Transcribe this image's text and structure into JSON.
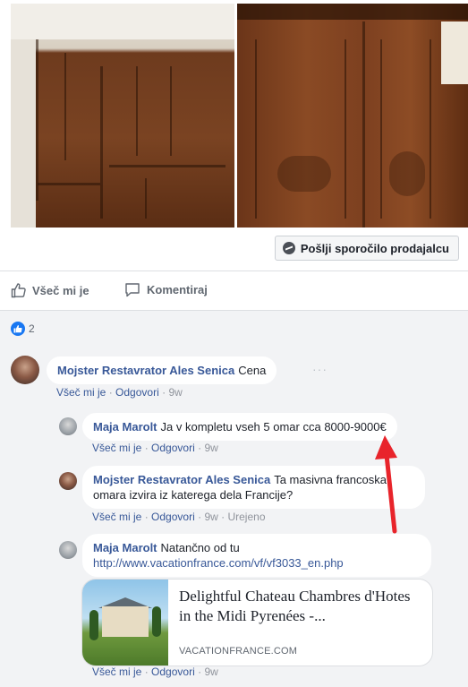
{
  "message_button": {
    "label": "Pošlji sporočilo prodajalcu",
    "icon": "messenger-icon"
  },
  "actions": {
    "like_label": "Všeč mi je",
    "comment_label": "Komentiraj"
  },
  "reactions": {
    "count": "2",
    "icon": "like-reaction-icon"
  },
  "comments": [
    {
      "author": "Mojster Restavrator Ales Senica",
      "text": "Cena",
      "like": "Všeč mi je",
      "reply": "Odgovori",
      "time": "9w",
      "more": "···"
    },
    {
      "author": "Maja Marolt",
      "text": "Ja v kompletu vseh 5 omar cca 8000-9000€",
      "like": "Všeč mi je",
      "reply": "Odgovori",
      "time": "9w"
    },
    {
      "author": "Mojster Restavrator Ales Senica",
      "text": "Ta masivna francoska omara izvira iz katerega dela Francije?",
      "like": "Všeč mi je",
      "reply": "Odgovori",
      "time": "9w",
      "edited": "Urejeno"
    },
    {
      "author": "Maja Marolt",
      "text": "Natančno od tu",
      "url": "http://www.vacationfrance.com/vf/vf3033_en.php",
      "like": "Všeč mi je",
      "reply": "Odgovori",
      "time": "9w"
    }
  ],
  "link_preview": {
    "title": "Delightful Chateau Chambres d'Hotes in the Midi Pyrenées -...",
    "domain": "VACATIONFRANCE.COM"
  },
  "meta_separator": "·",
  "colors": {
    "link_blue": "#385898",
    "background": "#f2f3f5",
    "arrow_red": "#e8242b"
  }
}
